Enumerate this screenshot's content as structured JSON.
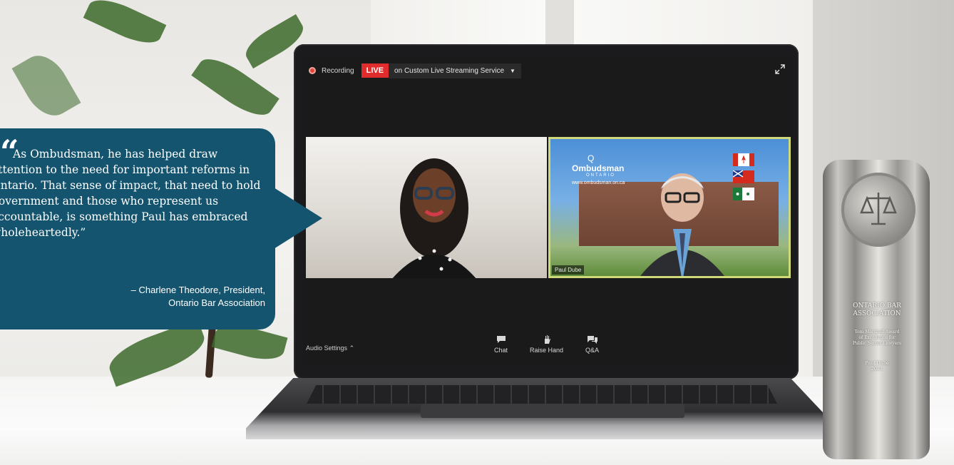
{
  "zoom": {
    "recording_label": "Recording",
    "live_label": "LIVE",
    "stream_service": "on Custom Live Streaming Service",
    "participants": [
      {
        "name": ""
      },
      {
        "name": "Paul Dube"
      }
    ],
    "ombudsman_logo": {
      "name": "Ombudsman",
      "sub": "ONTARIO",
      "url": "www.ombudsman.on.ca"
    },
    "toolbar": {
      "audio_settings": "Audio Settings",
      "chat": "Chat",
      "raise_hand": "Raise Hand",
      "qa": "Q&A"
    }
  },
  "quote": {
    "mark": "“",
    "text": "As Ombudsman, he has helped draw attention to the need for important reforms in Ontario. That sense of impact, that need to hold government and those who represent us accountable, is something Paul has embraced wholeheartedly.”",
    "attribution_line1": "– Charlene Theodore, President,",
    "attribution_line2": "Ontario Bar Association"
  },
  "trophy": {
    "org_line1": "ONTARIO BAR",
    "org_line2": "ASSOCIATION",
    "award_line1": "Tom Marshall Award",
    "award_line2": "of Excellence for",
    "award_line3": "Public Sector Lawyers",
    "recipient": "Paul Dubé",
    "year": "2021"
  },
  "colors": {
    "bubble": "#15546e",
    "live": "#e02c2c",
    "active_speaker_border": "#cfd97a"
  }
}
